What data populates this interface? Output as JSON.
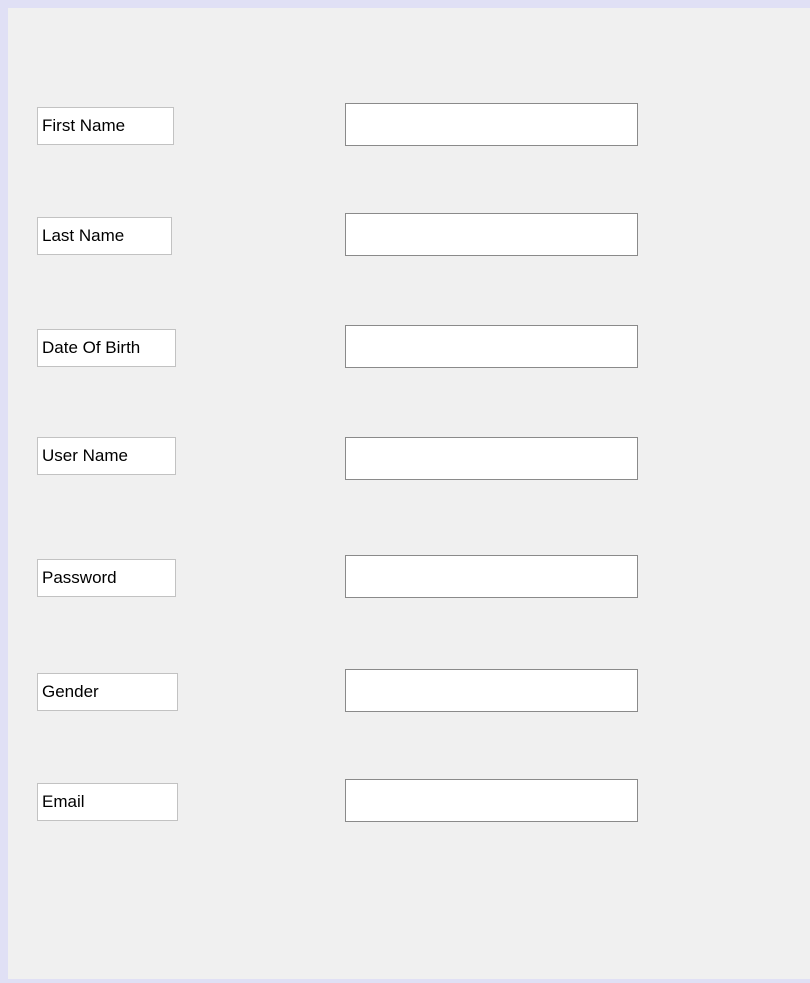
{
  "form": {
    "fields": [
      {
        "label": "First Name",
        "value": ""
      },
      {
        "label": "Last Name",
        "value": ""
      },
      {
        "label": "Date Of Birth",
        "value": ""
      },
      {
        "label": "User Name",
        "value": ""
      },
      {
        "label": "Password",
        "value": ""
      },
      {
        "label": "Gender",
        "value": ""
      },
      {
        "label": "Email",
        "value": ""
      }
    ]
  },
  "colors": {
    "frame": "#e0e0f5",
    "background": "#f0f0f0",
    "input_border": "#8a8a8a",
    "label_border": "#c2c2c2"
  }
}
